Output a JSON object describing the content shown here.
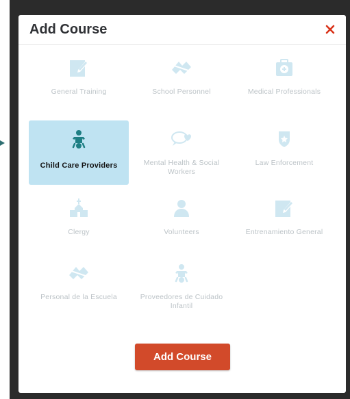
{
  "modal": {
    "title": "Add Course",
    "close_symbol": "×",
    "primary_button_label": "Add Course"
  },
  "options": [
    {
      "label": "General Training",
      "icon": "edit-icon",
      "selected": false
    },
    {
      "label": "School Personnel",
      "icon": "school-icon",
      "selected": false
    },
    {
      "label": "Medical Professionals",
      "icon": "medical-bag-icon",
      "selected": false
    },
    {
      "label": "Child Care Providers",
      "icon": "baby-icon",
      "selected": true
    },
    {
      "label": "Mental Health & Social Workers",
      "icon": "chat-heart-icon",
      "selected": false
    },
    {
      "label": "Law Enforcement",
      "icon": "badge-icon",
      "selected": false
    },
    {
      "label": "Clergy",
      "icon": "church-icon",
      "selected": false
    },
    {
      "label": "Volunteers",
      "icon": "person-icon",
      "selected": false
    },
    {
      "label": "Entrenamiento General",
      "icon": "edit-icon",
      "selected": false
    },
    {
      "label": "Personal de la Escuela",
      "icon": "school-icon",
      "selected": false
    },
    {
      "label": "Proveedores de Cuidado Infantil",
      "icon": "baby-icon",
      "selected": false
    }
  ],
  "colors": {
    "icon_default": "#cfe7f1",
    "icon_selected": "#1e7f84",
    "selected_tile_bg": "#bfe3f2",
    "primary": "#d24a2a",
    "close": "#d9331a",
    "label_default": "#bcc3c7"
  }
}
